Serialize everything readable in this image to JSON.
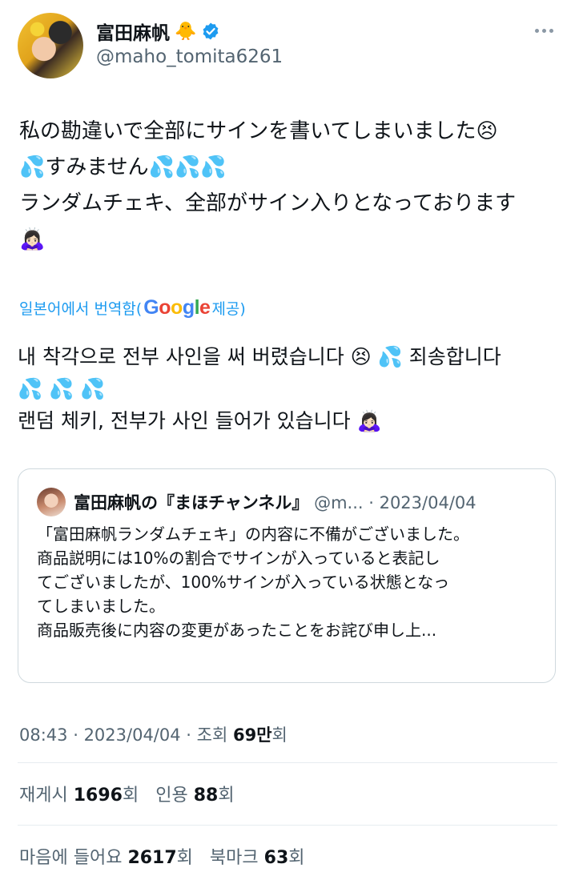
{
  "author": {
    "name": "富田麻帆",
    "name_emoji": "🐥",
    "handle": "@maho_tomita6261",
    "verified_color": "#1d9bf0"
  },
  "tweet": {
    "text": "私の勘違いで全部にサインを書いてしまいました😣\n💦すみません💦💦💦\nランダムチェキ、全部がサイン入りとなっております\n🙇🏻‍♀️"
  },
  "translation": {
    "prefix": "일본어에서 번역함(",
    "google": [
      "G",
      "o",
      "o",
      "g",
      "l",
      "e"
    ],
    "suffix": " 제공)",
    "text": "내 착각으로 전부 사인을 써 버렸습니다 😣 💦 죄송합니다\n💦 💦 💦\n랜덤 체키, 전부가 사인 들어가 있습니다 🙇🏻‍♀️"
  },
  "quote": {
    "name": "富田麻帆の『まほチャンネル』",
    "handle": "@m...",
    "separator": " · ",
    "date": "2023/04/04",
    "text": "「富田麻帆ランダムチェキ」の内容に不備がございました。\n商品説明には10%の割合でサインが入っていると表記し\nてございましたが、100%サインが入っている状態となっ\nてしまいました。\n商品販売後に内容の変更があったことをお詫び申し上..."
  },
  "meta": {
    "time": "08:43",
    "sep": " · ",
    "date": "2023/04/04",
    "views_label": "조회",
    "views_value": "69만",
    "views_suffix": "회"
  },
  "stats": {
    "reposts_label": "재게시",
    "reposts_value": "1696",
    "reposts_suffix": "회",
    "quotes_label": "인용",
    "quotes_value": "88",
    "quotes_suffix": "회",
    "likes_label": "마음에 들어요",
    "likes_value": "2617",
    "likes_suffix": "회",
    "bookmarks_label": "북마크",
    "bookmarks_value": "63",
    "bookmarks_suffix": "회"
  }
}
